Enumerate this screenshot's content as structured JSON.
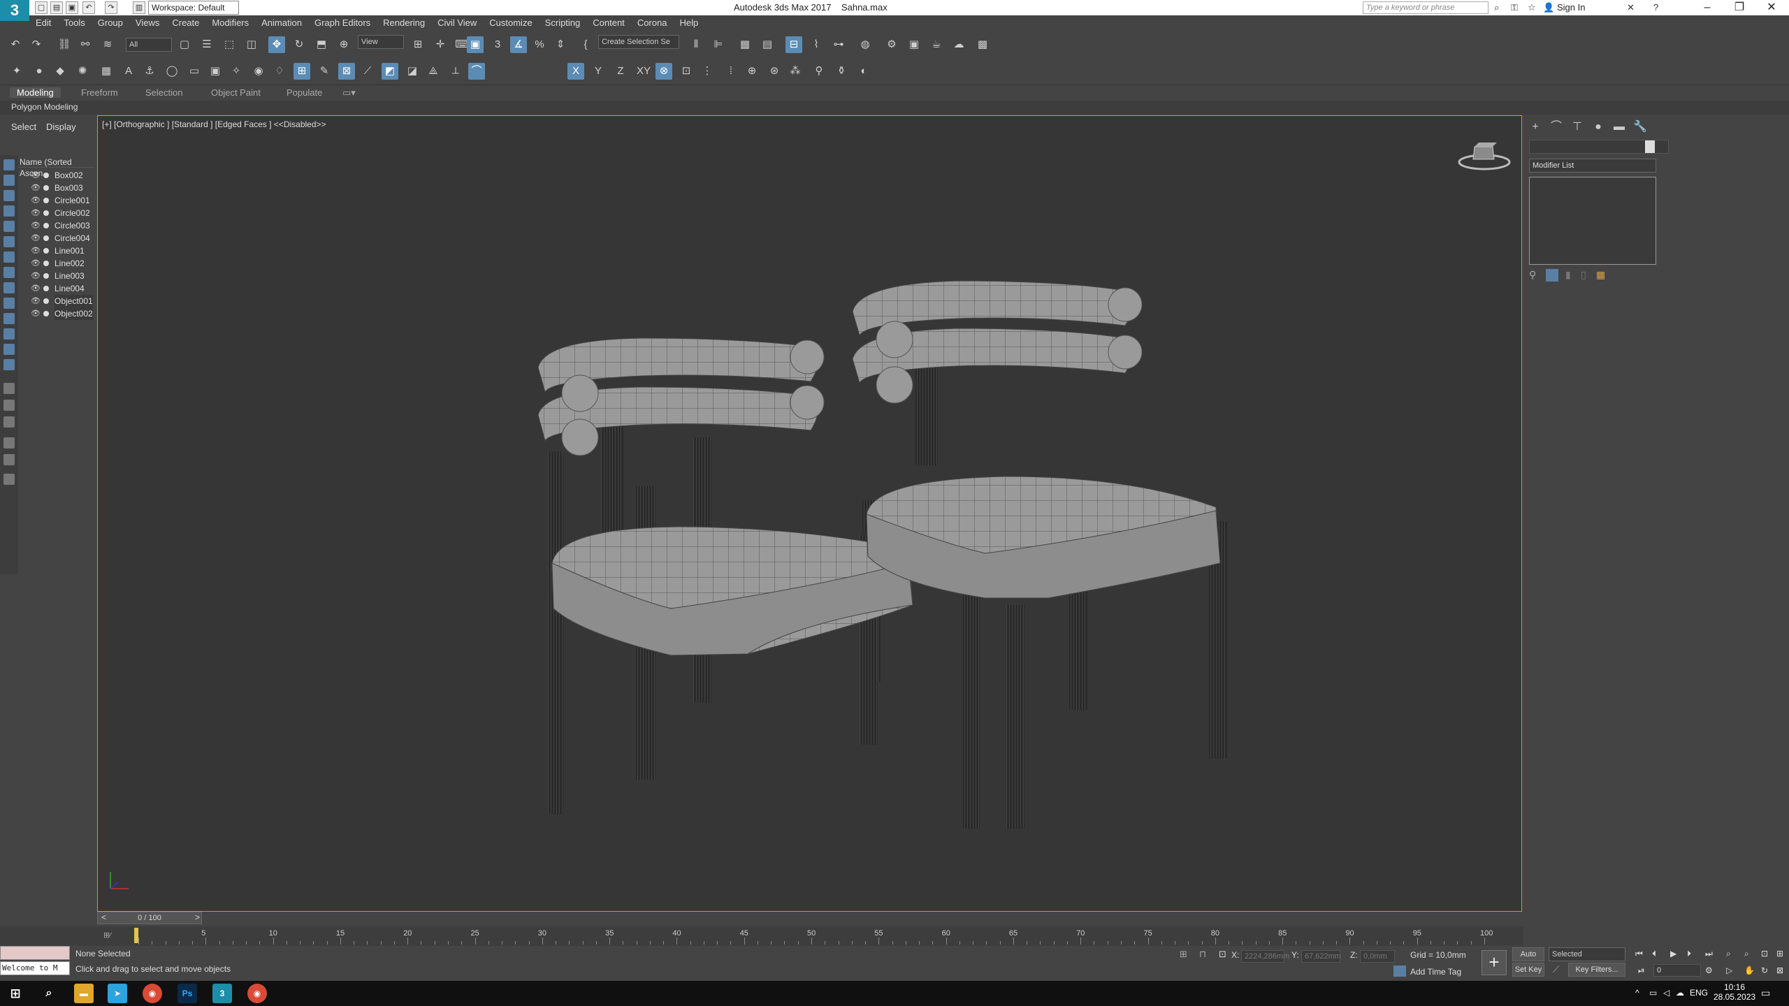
{
  "titlebar": {
    "app_logo": "3",
    "workspace": "Workspace: Default",
    "title": "Autodesk 3ds Max 2017",
    "filename": "Sahna.max",
    "search_placeholder": "Type a keyword or phrase",
    "sign_in": "Sign In"
  },
  "menu": [
    "Edit",
    "Tools",
    "Group",
    "Views",
    "Create",
    "Modifiers",
    "Animation",
    "Graph Editors",
    "Rendering",
    "Civil View",
    "Customize",
    "Scripting",
    "Content",
    "Corona",
    "Help"
  ],
  "toolbar": {
    "filter": "All",
    "ref_coord": "View",
    "selection_set": "Create Selection Se",
    "axis_x": "X",
    "axis_y": "Y",
    "axis_z": "Z",
    "axis_xy": "XY"
  },
  "ribbon": {
    "tabs": [
      "Modeling",
      "Freeform",
      "Selection",
      "Object Paint",
      "Populate"
    ],
    "sub": "Polygon Modeling"
  },
  "scene_explorer": {
    "tab_select": "Select",
    "tab_display": "Display",
    "header": "Name (Sorted Ascen",
    "items": [
      "Box002",
      "Box003",
      "Circle001",
      "Circle002",
      "Circle003",
      "Circle004",
      "Line001",
      "Line002",
      "Line003",
      "Line004",
      "Object001",
      "Object002"
    ]
  },
  "viewport": {
    "label": "[+] [Orthographic ] [Standard ] [Edged Faces ]  <<Disabled>>"
  },
  "command_panel": {
    "modifier_list": "Modifier List"
  },
  "timeline": {
    "frame": "0 / 100",
    "ticks": [
      "5",
      "10",
      "15",
      "20",
      "25",
      "30",
      "35",
      "40",
      "45",
      "50",
      "55",
      "60",
      "65",
      "70",
      "75",
      "80",
      "85",
      "90",
      "95",
      "100"
    ],
    "start": "0"
  },
  "status": {
    "maxscript_text": "Welcome to M",
    "selection": "None Selected",
    "prompt": "Click and drag to select and move objects",
    "x_label": "X:",
    "x_value": "2224,286mm",
    "y_label": "Y:",
    "y_value": "67,622mm",
    "z_label": "Z:",
    "z_value": "0,0mm",
    "grid": "Grid = 10,0mm",
    "add_time_tag": "Add Time Tag",
    "auto_key": "Auto Key",
    "selected": "Selected",
    "set_key": "Set Key",
    "key_filters": "Key Filters...",
    "frame_field": "0"
  },
  "taskbar": {
    "lang": "ENG",
    "time": "10:16",
    "date": "28.05.2023"
  }
}
